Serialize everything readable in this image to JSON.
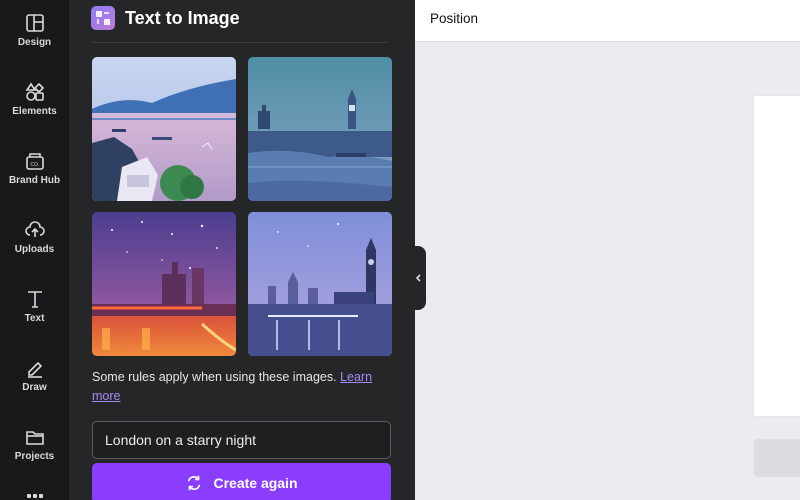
{
  "rail": {
    "items": [
      {
        "label": "Design",
        "icon": "layout-icon"
      },
      {
        "label": "Elements",
        "icon": "shapes-icon"
      },
      {
        "label": "Brand Hub",
        "icon": "brand-hub-icon"
      },
      {
        "label": "Uploads",
        "icon": "cloud-upload-icon"
      },
      {
        "label": "Text",
        "icon": "text-icon"
      },
      {
        "label": "Draw",
        "icon": "draw-icon"
      },
      {
        "label": "Projects",
        "icon": "folder-icon"
      }
    ]
  },
  "panel": {
    "title": "Text to Image",
    "rules_text": "Some rules apply when using these images.",
    "rules_link": "Learn more",
    "prompt_value": "London on a starry night",
    "create_label": "Create again"
  },
  "toolbar": {
    "position_label": "Position"
  },
  "colors": {
    "accent": "#8b3dff",
    "link": "#a78bfa",
    "rail_bg": "#18191b",
    "panel_bg": "#252627"
  }
}
